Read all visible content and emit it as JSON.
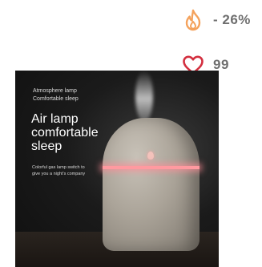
{
  "stats": {
    "discount_text": "- 26%",
    "likes_text": "99"
  },
  "icons": {
    "discount": "flame-icon",
    "likes": "heart-icon"
  },
  "colors": {
    "flame": "#f4a25c",
    "heart": "#d32f3f"
  },
  "product_image": {
    "brand_line1": "Atmosphere lamp",
    "brand_line2": "Comfortable sleep",
    "headline_line1": "Air lamp",
    "headline_line2": "comfortable",
    "headline_line3": "sleep",
    "tagline_line1": "Colorful gas lamp switch to",
    "tagline_line2": "give you a night's company"
  }
}
